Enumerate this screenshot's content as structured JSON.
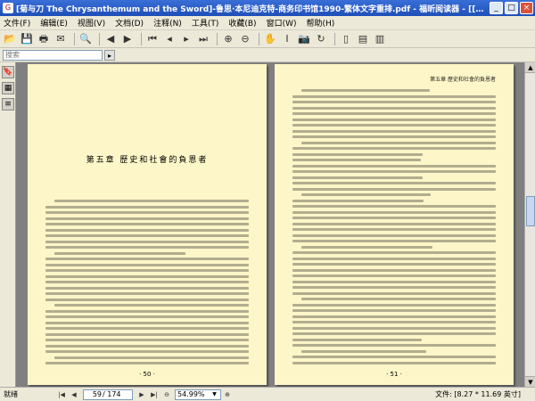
{
  "window": {
    "title": "[菊与刀 The Chrysanthemum and the Sword]-鲁思·本尼迪克特-商务印书馆1990-繁体文字重排.pdf - 福昕阅读器 - [[菊与刀 The Chrysanthemum and the Sword]-鲁思...",
    "minimize_label": "_",
    "maximize_label": "□",
    "close_label": "×"
  },
  "menu": {
    "items": [
      "文件(F)",
      "编辑(E)",
      "视图(V)",
      "文档(D)",
      "注释(N)",
      "工具(T)",
      "收藏(B)",
      "窗口(W)",
      "帮助(H)"
    ]
  },
  "toolbar": {
    "icons": [
      "open-icon",
      "save-icon",
      "print-icon",
      "email-icon",
      "search-icon",
      "back-icon",
      "forward-icon",
      "first-page-icon",
      "prev-page-icon",
      "next-page-icon",
      "last-page-icon",
      "zoom-in-icon",
      "zoom-out-icon",
      "hand-icon",
      "select-text-icon",
      "snapshot-icon",
      "rotate-icon",
      "single-page-icon",
      "continuous-icon",
      "facing-icon"
    ]
  },
  "addressbar": {
    "placeholder": "搜索",
    "go_label": "▸"
  },
  "pages": {
    "left": {
      "chapter_title": "第五章  歷史和社會的負恩者",
      "page_number": "· 50 ·"
    },
    "right": {
      "running_head": "第五章  歷史和社會的負恩者",
      "page_number": "· 51 ·"
    }
  },
  "statusbar": {
    "status": "就绪",
    "current_page": "59",
    "total_pages": "/ 174",
    "zoom": "54.99%",
    "doc_size": "文件: [8.27 * 11.69 英寸]"
  }
}
